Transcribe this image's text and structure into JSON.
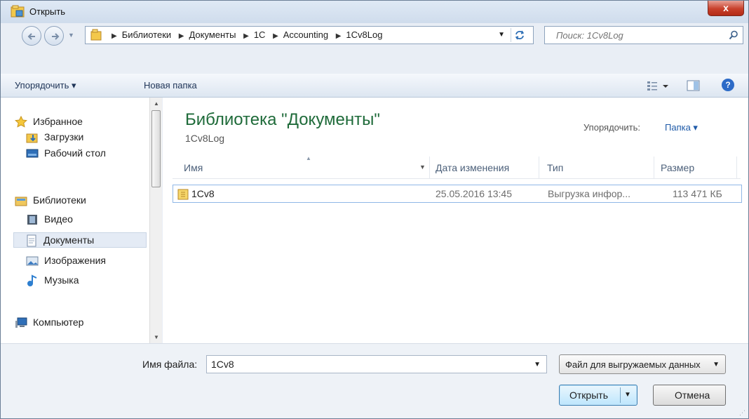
{
  "window": {
    "title": "Открыть",
    "close_label": "x"
  },
  "address": {
    "crumbs": [
      "Библиотеки",
      "Документы",
      "1С",
      "Accounting",
      "1Cv8Log"
    ],
    "search_placeholder": "Поиск: 1Cv8Log"
  },
  "toolbar": {
    "organize_label": "Упорядочить ▾",
    "new_folder_label": "Новая папка",
    "help_label": "?"
  },
  "sidebar": {
    "items": [
      {
        "label": "Избранное",
        "icon": "star-icon"
      },
      {
        "label": "Загрузки",
        "icon": "downloads-folder-icon"
      },
      {
        "label": "Рабочий стол",
        "icon": "desktop-icon"
      },
      {
        "label": "Библиотеки",
        "icon": "libraries-icon"
      },
      {
        "label": "Видео",
        "icon": "video-icon"
      },
      {
        "label": "Документы",
        "icon": "documents-icon",
        "selected": true
      },
      {
        "label": "Изображения",
        "icon": "images-icon"
      },
      {
        "label": "Музыка",
        "icon": "music-icon"
      },
      {
        "label": "Компьютер",
        "icon": "computer-icon"
      }
    ]
  },
  "content": {
    "library_title": "Библиотека \"Документы\"",
    "library_subtitle": "1Cv8Log",
    "arrange_label": "Упорядочить:",
    "arrange_value": "Папка ▾",
    "columns": [
      "Имя",
      "Дата изменения",
      "Тип",
      "Размер"
    ],
    "rows": [
      {
        "name": "1Cv8",
        "date": "25.05.2016 13:45",
        "type": "Выгрузка инфор...",
        "size": "113 471 КБ"
      }
    ]
  },
  "footer": {
    "filename_label": "Имя файла:",
    "filename_value": "1Cv8",
    "filetype_value": "Файл для выгружаемых данных",
    "open_label": "Открыть",
    "cancel_label": "Отмена"
  },
  "colors": {
    "library_title": "#1f6b3a",
    "link_blue": "#1e5aa8",
    "selection_border": "#8fb7e6",
    "close_red": "#c8402b"
  }
}
